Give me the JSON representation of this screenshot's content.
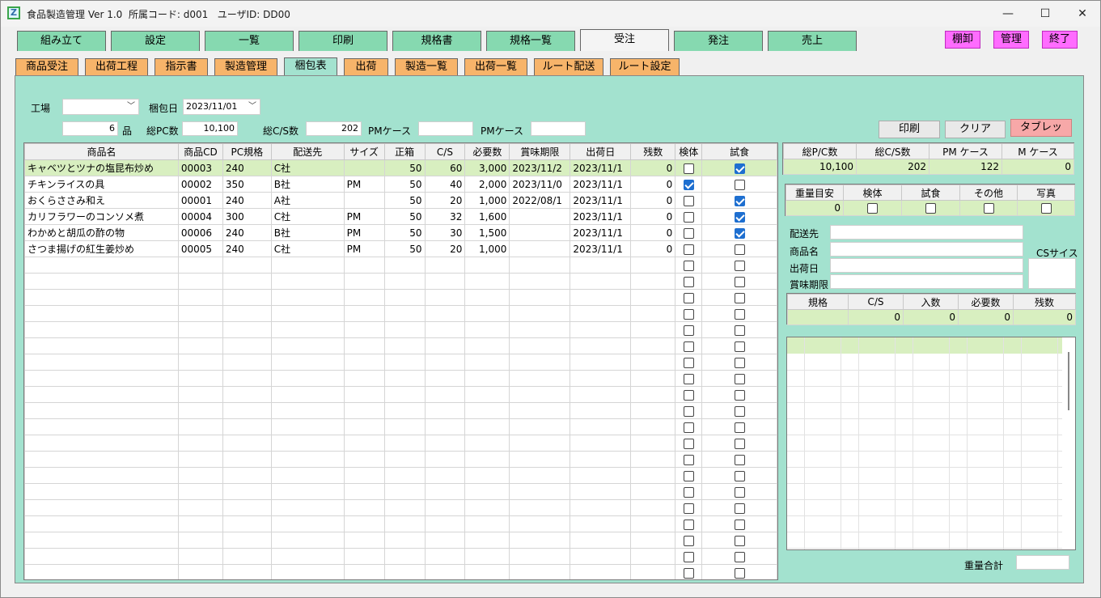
{
  "window": {
    "title": "食品製造管理 Ver 1.0  所属コード: d001   ユーザID: DD00",
    "icon": "Z",
    "minimize": "—",
    "maximize": "☐",
    "close": "✕"
  },
  "main_tabs": [
    "組み立て",
    "設定",
    "一覧",
    "印刷",
    "規格書",
    "規格一覧",
    "受注",
    "発注",
    "売上"
  ],
  "main_active": "受注",
  "top_buttons": [
    "棚卸",
    "管理",
    "終了"
  ],
  "sub_tabs": [
    "商品受注",
    "出荷工程",
    "指示書",
    "製造管理",
    "梱包表",
    "出荷",
    "製造一覧",
    "出荷一覧",
    "ルート配送",
    "ルート設定"
  ],
  "sub_active": "梱包表",
  "form": {
    "factory_label": "工場",
    "factory_value": "",
    "pack_date_label": "梱包日",
    "pack_date_value": "2023/11/01",
    "item_count": "6",
    "item_unit": "品",
    "total_pc_label": "総PC数",
    "total_pc_value": "10,100",
    "total_cs_label": "総C/S数",
    "total_cs_value": "202",
    "pm_case_label1": "PMケース",
    "pm_case_value1": "",
    "pm_case_label2": "PMケース",
    "pm_case_value2": ""
  },
  "buttons": {
    "print": "印刷",
    "clear": "クリア",
    "tablet": "タブレッ"
  },
  "grid": {
    "headers": [
      "商品名",
      "商品CD",
      "PC規格",
      "配送先",
      "サイズ",
      "正箱",
      "C/S",
      "必要数",
      "賞味期限",
      "出荷日",
      "残数",
      "検体",
      "試食"
    ],
    "rows": [
      {
        "name": "キャベツとツナの塩昆布炒め",
        "cd": "00003",
        "pc": "240",
        "dest": "C社",
        "size": "",
        "box": "50",
        "cs": "60",
        "need": "3,000",
        "best": "2023/11/2",
        "ship": "2023/11/1",
        "rem": "0",
        "sample": false,
        "taste": true,
        "selected": true
      },
      {
        "name": "チキンライスの具",
        "cd": "00002",
        "pc": "350",
        "dest": "B社",
        "size": "PM",
        "box": "50",
        "cs": "40",
        "need": "2,000",
        "best": "2023/11/0",
        "ship": "2023/11/1",
        "rem": "0",
        "sample": true,
        "taste": false,
        "selected": false
      },
      {
        "name": "おくらささみ和え",
        "cd": "00001",
        "pc": "240",
        "dest": "A社",
        "size": "",
        "box": "50",
        "cs": "20",
        "need": "1,000",
        "best": "2022/08/1",
        "ship": "2023/11/1",
        "rem": "0",
        "sample": false,
        "taste": true,
        "selected": false
      },
      {
        "name": "カリフラワーのコンソメ煮",
        "cd": "00004",
        "pc": "300",
        "dest": "C社",
        "size": "PM",
        "box": "50",
        "cs": "32",
        "need": "1,600",
        "best": "",
        "ship": "2023/11/1",
        "rem": "0",
        "sample": false,
        "taste": true,
        "selected": false
      },
      {
        "name": "わかめと胡瓜の酢の物",
        "cd": "00006",
        "pc": "240",
        "dest": "B社",
        "size": "PM",
        "box": "50",
        "cs": "30",
        "need": "1,500",
        "best": "",
        "ship": "2023/11/1",
        "rem": "0",
        "sample": false,
        "taste": true,
        "selected": false
      },
      {
        "name": "さつま揚げの紅生姜炒め",
        "cd": "00005",
        "pc": "240",
        "dest": "C社",
        "size": "PM",
        "box": "50",
        "cs": "20",
        "need": "1,000",
        "best": "",
        "ship": "2023/11/1",
        "rem": "0",
        "sample": false,
        "taste": false,
        "selected": false
      }
    ],
    "empty_rows": 20
  },
  "summary": {
    "headers": [
      "総P/C数",
      "総C/S数",
      "PM ケース",
      "M ケース"
    ],
    "values": [
      "10,100",
      "202",
      "122",
      "0"
    ]
  },
  "weight": {
    "headers": [
      "重量目安",
      "検体",
      "試食",
      "その他",
      "写真"
    ],
    "value": "0"
  },
  "detail": {
    "dest_label": "配送先",
    "name_label": "商品名",
    "ship_label": "出荷日",
    "best_label": "賞味期限",
    "cs_size_label": "CSサイス"
  },
  "spec": {
    "headers": [
      "規格",
      "C/S",
      "入数",
      "必要数",
      "残数"
    ],
    "values": [
      "",
      "0",
      "0",
      "0",
      "0"
    ]
  },
  "weight_total_label": "重量合計"
}
